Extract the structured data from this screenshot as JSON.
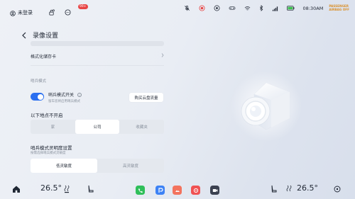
{
  "status_bar": {
    "user_label": "未登录",
    "message_badge": "99+",
    "time": "08:30AM",
    "airbag_label": "PASSENGER AIRBAG OFF",
    "airbag_line1": "PASSENGER",
    "airbag_line2": "AIRBAG",
    "airbag_line3": "OFF"
  },
  "settings": {
    "back_icon": "chevron-left-icon",
    "title": "录像设置",
    "format_card_label": "格式化储存卡",
    "sentry_section_label": "哨兵模式",
    "sentry_toggle": {
      "label": "哨兵模式开关",
      "description": "留车您将启用哨兵模式",
      "enabled": true
    },
    "buy_cloud_button": "购买云盘流量",
    "exclude_locations": {
      "title": "以下地点不开启",
      "options": [
        "家",
        "公司",
        "收藏夹"
      ],
      "selected": "公司"
    },
    "sensitivity": {
      "title": "哨兵模式灵明度设置",
      "description": "按需选择哨兵模式灵敏度",
      "options": [
        "低灵敏度",
        "高灵敏度"
      ],
      "selected": "低灵敏度"
    }
  },
  "dock": {
    "left_temp": "26.5°",
    "right_temp": "26.5°",
    "apps": [
      "phone-app-icon",
      "maps-app-icon",
      "photos-app-icon",
      "media-app-icon",
      "camera-app-icon"
    ]
  },
  "colors": {
    "accent": "#2a6ff0",
    "toggle_on": "#2a6ff0",
    "badge": "#e84545",
    "airbag": "#d9902b"
  }
}
